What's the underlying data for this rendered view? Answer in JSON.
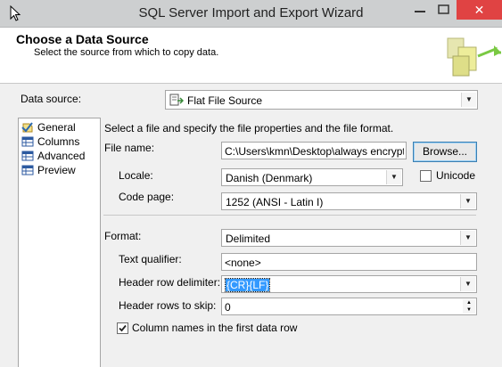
{
  "window": {
    "title": "SQL Server Import and Export Wizard",
    "close_symbol": "✕"
  },
  "header": {
    "title": "Choose a Data Source",
    "subtitle": "Select the source from which to copy data."
  },
  "data_source": {
    "label": "Data source:",
    "value": "Flat File Source"
  },
  "nav": {
    "items": [
      {
        "label": "General",
        "icon": "general-icon",
        "selected": true
      },
      {
        "label": "Columns",
        "icon": "grid-icon"
      },
      {
        "label": "Advanced",
        "icon": "grid-icon"
      },
      {
        "label": "Preview",
        "icon": "grid-icon"
      }
    ]
  },
  "general": {
    "instruction": "Select a file and specify the file properties and the file format.",
    "file_name_label": "File name:",
    "file_name_value": "C:\\Users\\kmn\\Desktop\\always encrypted.",
    "browse_label": "Browse...",
    "locale_label": "Locale:",
    "locale_value": "Danish (Denmark)",
    "unicode_label": "Unicode",
    "code_page_label": "Code page:",
    "code_page_value": "1252  (ANSI - Latin I)",
    "format_label": "Format:",
    "format_value": "Delimited",
    "text_qualifier_label": "Text qualifier:",
    "text_qualifier_value": "<none>",
    "header_row_delimiter_label": "Header row delimiter:",
    "header_row_delimiter_value": "{CR}{LF}",
    "header_rows_skip_label": "Header rows to skip:",
    "header_rows_skip_value": "0",
    "column_names_label": "Column names in the first data row",
    "column_names_checked": true,
    "unicode_checked": false
  }
}
